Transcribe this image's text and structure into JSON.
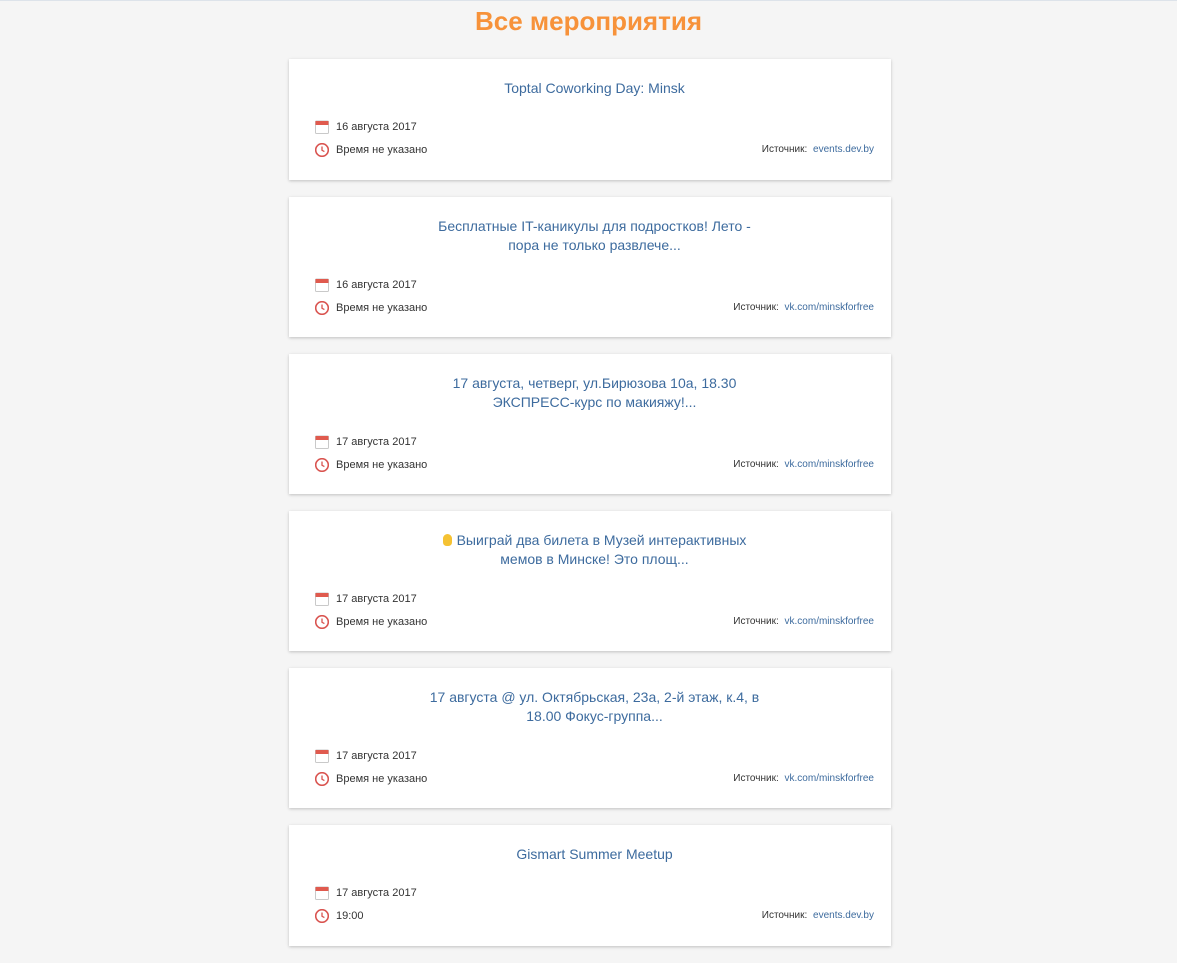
{
  "page": {
    "title": "Все мероприятия"
  },
  "labels": {
    "source_prefix": "Источник:"
  },
  "events": [
    {
      "title_lines": [
        "Toptal Coworking Day: Minsk"
      ],
      "date": "16 августа 2017",
      "time": "Время не указано",
      "source": "events.dev.by"
    },
    {
      "title_lines": [
        "Бесплатные IT-каникулы для подростков! Лето -",
        "пора не только развлече..."
      ],
      "date": "16 августа 2017",
      "time": "Время не указано",
      "source": "vk.com/minskforfree"
    },
    {
      "title_lines": [
        "17 августа, четверг, ул.Бирюзова 10а, 18.30",
        "ЭКСПРЕСС-курс по макияжу!..."
      ],
      "date": "17 августа 2017",
      "time": "Время не указано",
      "source": "vk.com/minskforfree"
    },
    {
      "title_lines": [
        "Выиграй два билета в Музей интерактивных",
        "мемов в Минске! Это площ..."
      ],
      "title_emoji": "raised-hand-icon",
      "date": "17 августа 2017",
      "time": "Время не указано",
      "source": "vk.com/minskforfree"
    },
    {
      "title_lines": [
        "17 августа @ ул. Октябрьская, 23а, 2-й этаж, к.4, в",
        "18.00 Фокус-группа..."
      ],
      "date": "17 августа 2017",
      "time": "Время не указано",
      "source": "vk.com/minskforfree"
    },
    {
      "title_lines": [
        "Gismart Summer Meetup"
      ],
      "date": "17 августа 2017",
      "time": "19:00",
      "source": "events.dev.by"
    }
  ],
  "colors": {
    "accent": "#f7923a",
    "link": "#3d6b9e",
    "calendar_icon": "#e05a4e",
    "clock_icon": "#d9534f"
  }
}
